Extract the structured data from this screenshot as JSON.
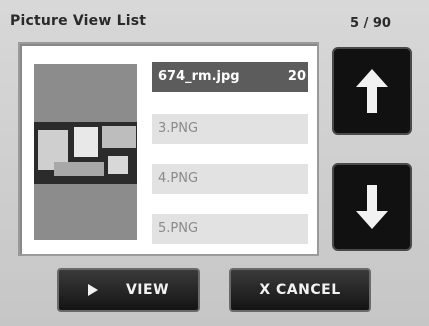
{
  "header": {
    "title": "Picture View List",
    "counter": "5 / 90"
  },
  "list": {
    "items": [
      {
        "name": "674_rm.jpg",
        "aux": "20",
        "selected": true
      },
      {
        "name": "3.PNG",
        "selected": false
      },
      {
        "name": "4.PNG",
        "selected": false
      },
      {
        "name": "5.PNG",
        "selected": false
      }
    ]
  },
  "icons": {
    "scroll_up": "up-arrow-icon",
    "scroll_down": "down-arrow-icon",
    "view": "play-icon"
  },
  "buttons": {
    "view_label": "VIEW",
    "cancel_label": "X CANCEL"
  },
  "colors": {
    "selected_bg": "#5c5c5c",
    "item_bg": "#e2e2e2",
    "button_bg": "#111111"
  }
}
